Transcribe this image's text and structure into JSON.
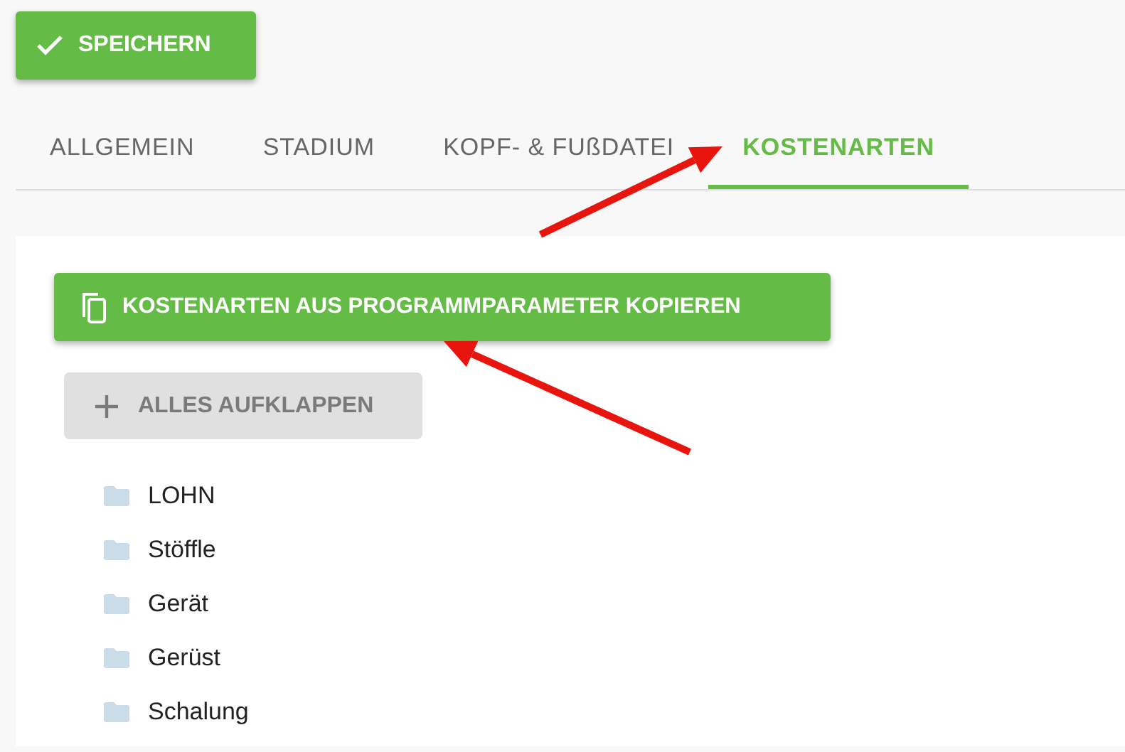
{
  "save_button": {
    "label": "SPEICHERN"
  },
  "tabs": [
    {
      "label": "ALLGEMEIN",
      "selected": false
    },
    {
      "label": "STADIUM",
      "selected": false
    },
    {
      "label": "KOPF- & FUßDATEI",
      "selected": false
    },
    {
      "label": "KOSTENARTEN",
      "selected": true
    }
  ],
  "copy_button": {
    "label": "KOSTENARTEN AUS PROGRAMMPARAMETER KOPIEREN"
  },
  "expand_button": {
    "label": "ALLES AUFKLAPPEN",
    "disabled": true
  },
  "tree": [
    {
      "label": "LOHN"
    },
    {
      "label": "Stöffle"
    },
    {
      "label": "Gerät"
    },
    {
      "label": "Gerüst"
    },
    {
      "label": "Schalung"
    }
  ],
  "annotations": [
    {
      "kind": "arrow"
    },
    {
      "kind": "arrow"
    }
  ]
}
